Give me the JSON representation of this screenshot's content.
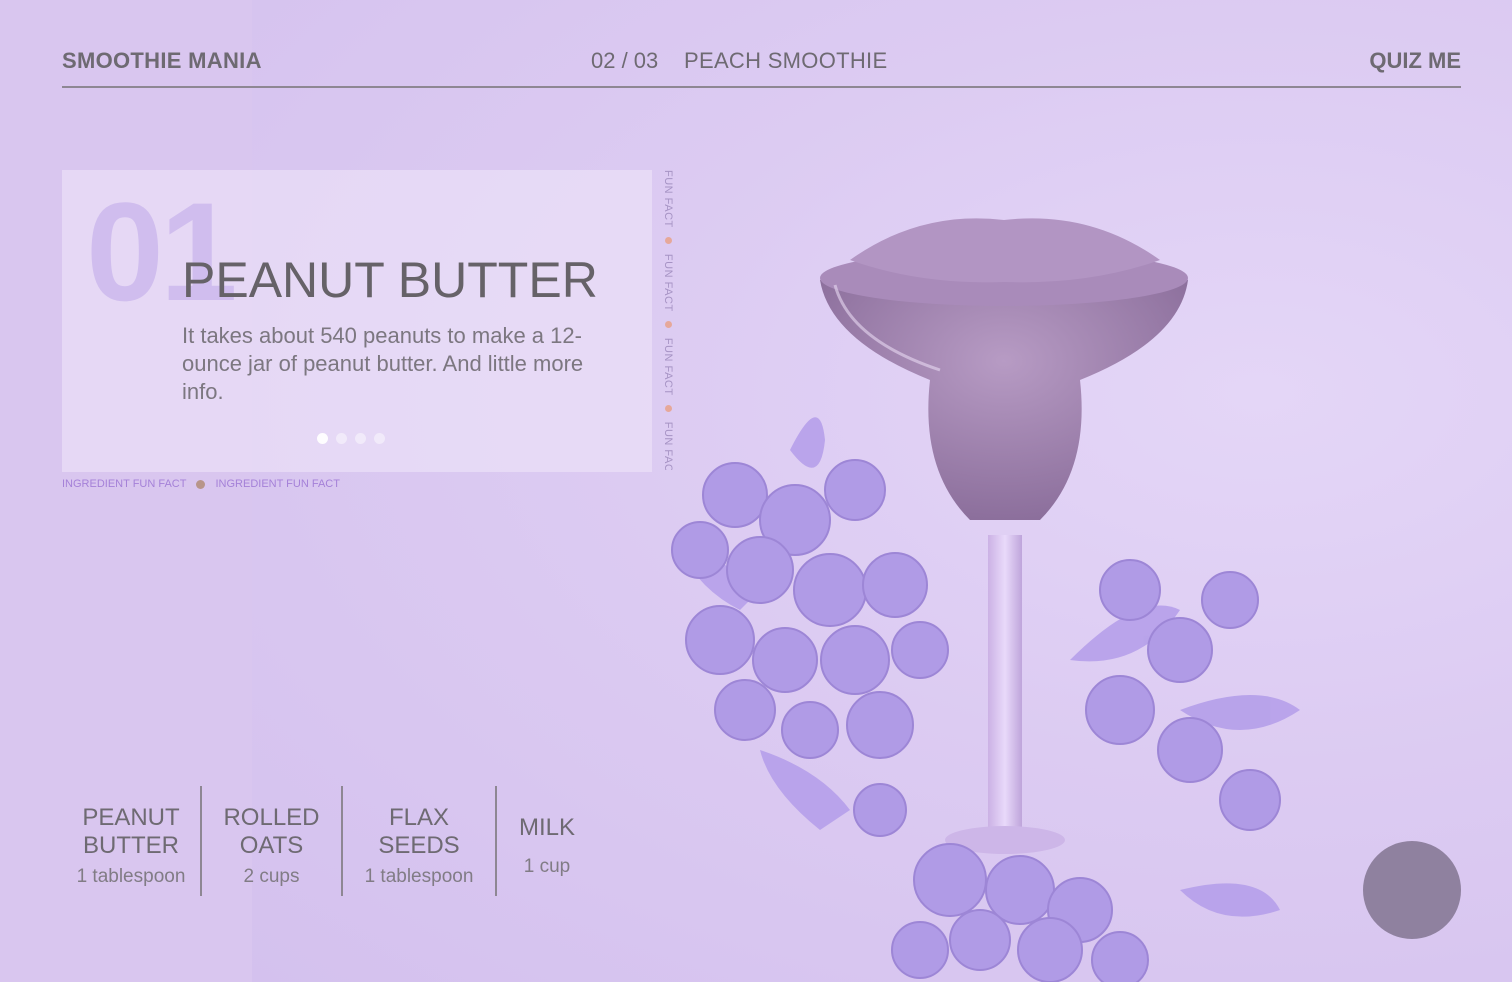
{
  "header": {
    "brand": "SMOOTHIE MANIA",
    "counter": "02 / 03",
    "smoothie_name": "PEACH SMOOTHIE",
    "quiz_label": "QUIZ ME"
  },
  "fact_card": {
    "number": "01",
    "title": "PEANUT BUTTER",
    "text": "It takes about 540 peanuts to make a 12-ounce jar of peanut butter. And little more info.",
    "pager": {
      "total": 4,
      "active": 1
    }
  },
  "vertical_label": "FUN FACT",
  "fact_links": [
    "INGREDIENT FUN FACT",
    "INGREDIENT FUN FACT"
  ],
  "ingredients": [
    {
      "name_line1": "PEANUT",
      "name_line2": "BUTTER",
      "qty": "1 tablespoon"
    },
    {
      "name_line1": "ROLLED",
      "name_line2": "OATS",
      "qty": "2 cups"
    },
    {
      "name_line1": "FLAX",
      "name_line2": "SEEDS",
      "qty": "1 tablespoon"
    },
    {
      "name_line1": "MILK",
      "qty": "1 cup"
    }
  ],
  "colors": {
    "accent": "#a581d8",
    "background": "#dccbf2",
    "text": "#6e6a72",
    "fab": "#8f819f"
  },
  "icons": {
    "floating_button": "circle-button"
  }
}
